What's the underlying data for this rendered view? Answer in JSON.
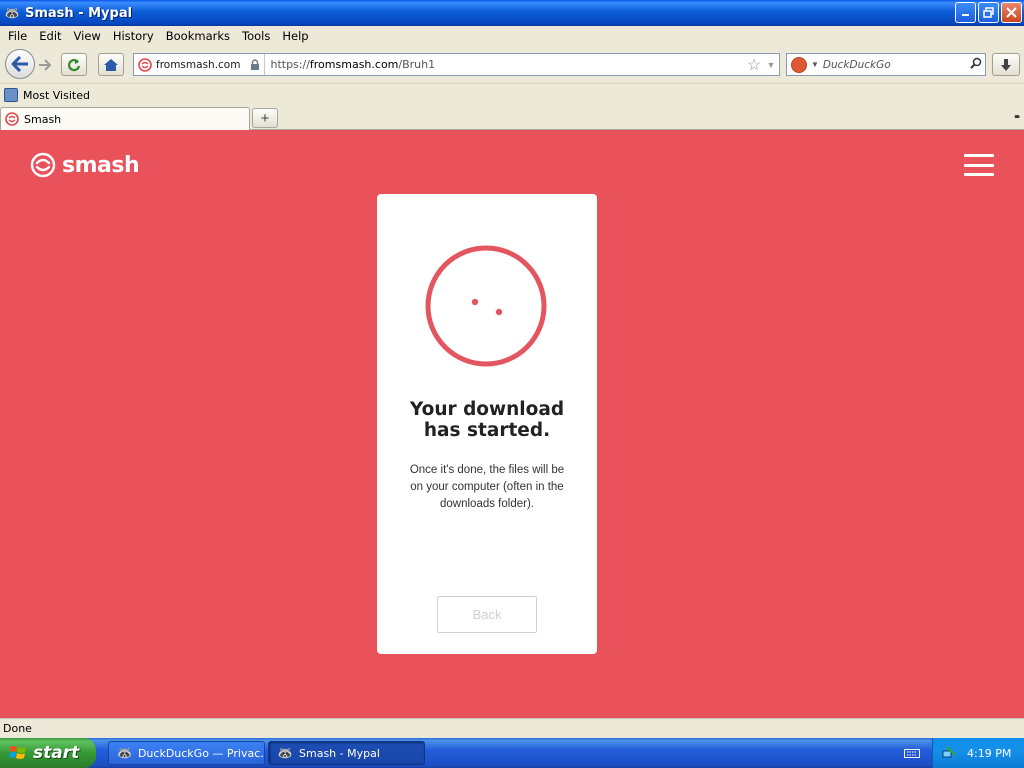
{
  "window": {
    "title": "Smash - Mypal",
    "minimize": "_",
    "restore": "❐",
    "close": "✕"
  },
  "menu": [
    "File",
    "Edit",
    "View",
    "History",
    "Bookmarks",
    "Tools",
    "Help"
  ],
  "nav": {
    "site_domain": "fromsmash.com",
    "url_prefix": "https://",
    "url_host": "fromsmash.com",
    "url_path": "/Bruh1",
    "search_placeholder": "DuckDuckGo"
  },
  "bookmarks": {
    "most_visited": "Most Visited"
  },
  "tabs": [
    {
      "label": "Smash"
    }
  ],
  "page": {
    "brand_name": "smash",
    "heading_line1": "Your download",
    "heading_line2": "has started.",
    "body_line1": "Once it's done, the files will be",
    "body_line2": "on your computer (often in the",
    "body_line3": "downloads folder).",
    "back_button": "Back",
    "accent_color": "#ea525b"
  },
  "status": {
    "text": "Done"
  },
  "taskbar": {
    "start_label": "start",
    "items": [
      {
        "label": "DuckDuckGo — Privac..."
      },
      {
        "label": "Smash - Mypal"
      }
    ],
    "clock": "4:19 PM"
  }
}
